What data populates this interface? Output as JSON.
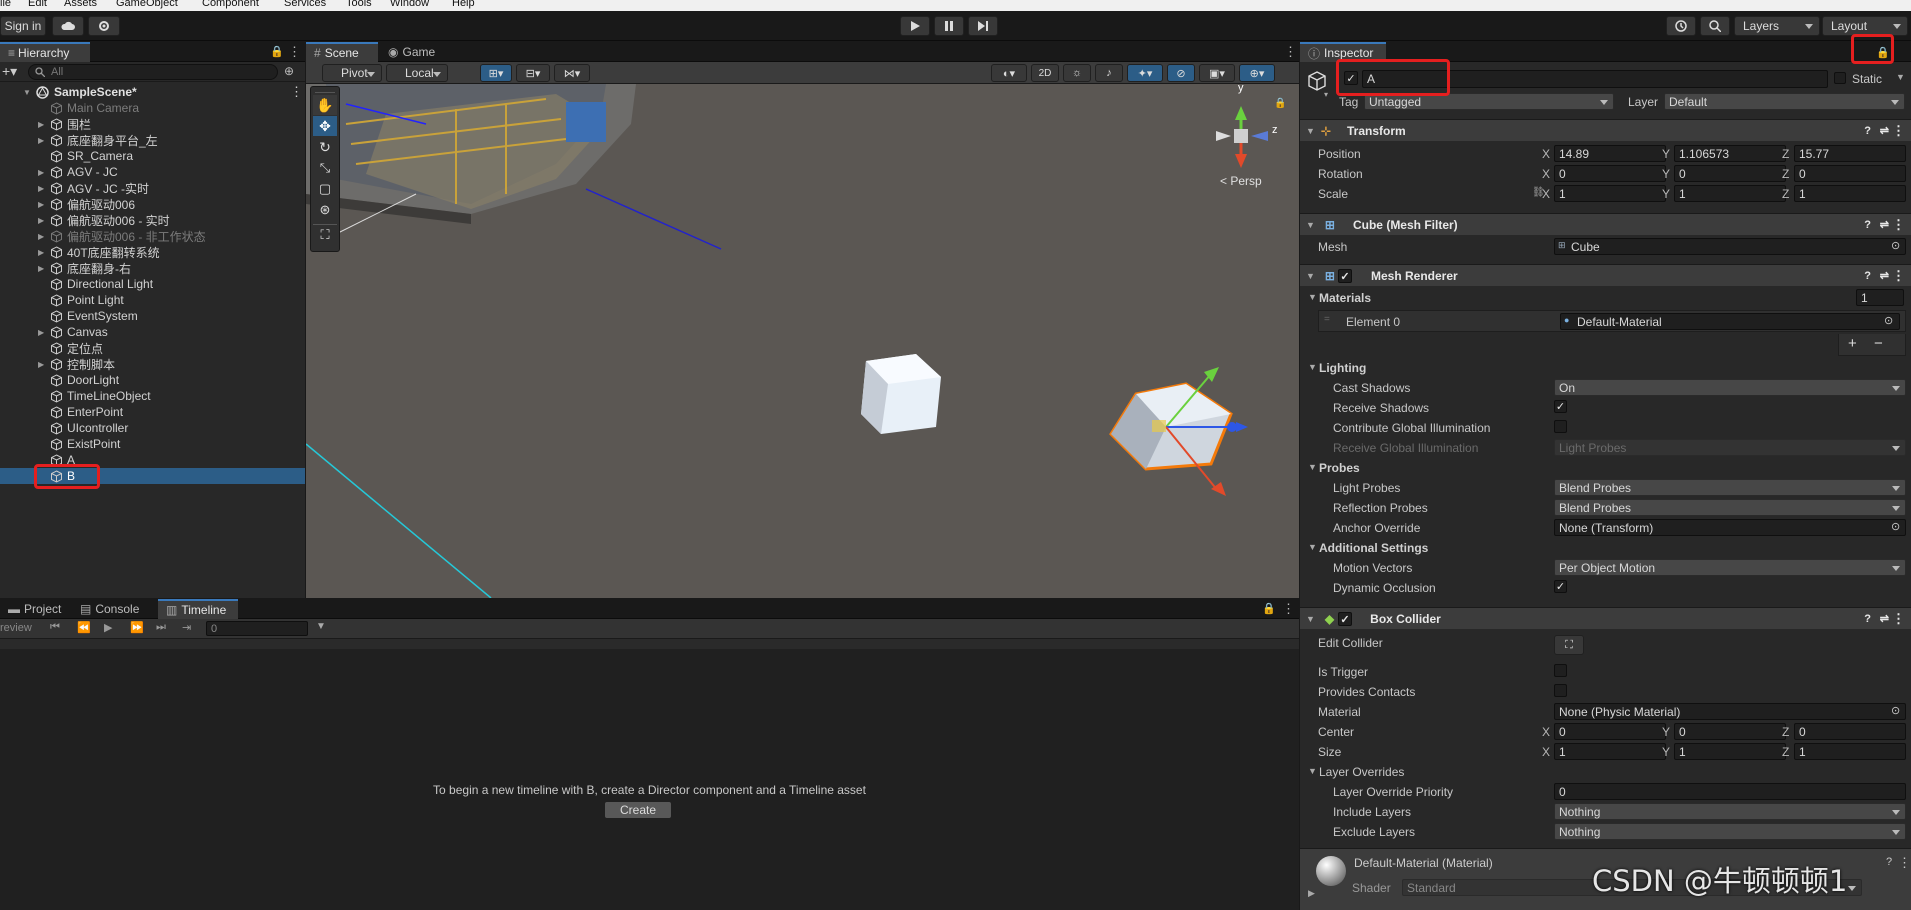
{
  "menu": [
    "ile",
    "Edit",
    "Assets",
    "GameObject",
    "Component",
    "Services",
    "Tools",
    "Window",
    "Help"
  ],
  "toolbar": {
    "sign_in": "Sign in",
    "layers": "Layers",
    "layout": "Layout"
  },
  "hierarchy": {
    "tab": "Hierarchy",
    "search_placeholder": "All",
    "scene": "SampleScene*",
    "items": [
      {
        "label": "Main Camera"
      },
      {
        "label": "围栏"
      },
      {
        "label": "底座翻身平台_左"
      },
      {
        "label": "SR_Camera"
      },
      {
        "label": "AGV - JC"
      },
      {
        "label": "AGV - JC -实时"
      },
      {
        "label": "偏航驱动006"
      },
      {
        "label": "偏航驱动006 - 实时"
      },
      {
        "label": "偏航驱动006 - 非工作状态"
      },
      {
        "label": "40T底座翻转系统"
      },
      {
        "label": "底座翻身-右"
      },
      {
        "label": "Directional Light"
      },
      {
        "label": "Point Light"
      },
      {
        "label": "EventSystem"
      },
      {
        "label": "Canvas"
      },
      {
        "label": "定位点"
      },
      {
        "label": "控制脚本"
      },
      {
        "label": "DoorLight"
      },
      {
        "label": "TimeLineObject"
      },
      {
        "label": "EnterPoint"
      },
      {
        "label": "UIcontroller"
      },
      {
        "label": "ExistPoint"
      },
      {
        "label": "A"
      },
      {
        "label": "B"
      }
    ]
  },
  "scene": {
    "tabs": [
      "Scene",
      "Game"
    ],
    "pivot": "Pivot",
    "local": "Local",
    "mode_2d": "2D",
    "persp": "< Persp",
    "gizmo_y": "y",
    "gizmo_z": "z"
  },
  "bottom": {
    "tabs": [
      "Project",
      "Console",
      "Timeline"
    ],
    "preview": "review",
    "frame": "0",
    "message": "To begin a new timeline with B, create a Director component and a Timeline asset",
    "create": "Create"
  },
  "inspector": {
    "tab": "Inspector",
    "object_name": "A",
    "static": "Static",
    "tag_label": "Tag",
    "tag": "Untagged",
    "layer_label": "Layer",
    "layer": "Default",
    "transform": {
      "title": "Transform",
      "position_label": "Position",
      "position": [
        "14.89",
        "1.106573",
        "15.77"
      ],
      "rotation_label": "Rotation",
      "rotation": [
        "0",
        "0",
        "0"
      ],
      "scale_label": "Scale",
      "scale": [
        "1",
        "1",
        "1"
      ]
    },
    "mesh_filter": {
      "title": "Cube (Mesh Filter)",
      "mesh_label": "Mesh",
      "mesh": "Cube"
    },
    "mesh_renderer": {
      "title": "Mesh Renderer",
      "materials_label": "Materials",
      "materials_count": "1",
      "element0_label": "Element 0",
      "element0": "Default-Material",
      "lighting": "Lighting",
      "cast_shadows_label": "Cast Shadows",
      "cast_shadows": "On",
      "receive_shadows_label": "Receive Shadows",
      "contribute_gi_label": "Contribute Global Illumination",
      "receive_gi_label": "Receive Global Illumination",
      "receive_gi": "Light Probes",
      "probes": "Probes",
      "light_probes_label": "Light Probes",
      "light_probes": "Blend Probes",
      "reflection_probes_label": "Reflection Probes",
      "reflection_probes": "Blend Probes",
      "anchor_override_label": "Anchor Override",
      "anchor_override": "None (Transform)",
      "additional": "Additional Settings",
      "motion_vectors_label": "Motion Vectors",
      "motion_vectors": "Per Object Motion",
      "dynamic_occlusion_label": "Dynamic Occlusion"
    },
    "box_collider": {
      "title": "Box Collider",
      "edit_collider": "Edit Collider",
      "is_trigger": "Is Trigger",
      "provides_contacts": "Provides Contacts",
      "material_label": "Material",
      "material": "None (Physic Material)",
      "center_label": "Center",
      "center": [
        "0",
        "0",
        "0"
      ],
      "size_label": "Size",
      "size": [
        "1",
        "1",
        "1"
      ],
      "layer_overrides": "Layer Overrides",
      "priority_label": "Layer Override Priority",
      "priority": "0",
      "include_label": "Include Layers",
      "include": "Nothing",
      "exclude_label": "Exclude Layers",
      "exclude": "Nothing"
    },
    "material": {
      "title": "Default-Material (Material)",
      "shader_label": "Shader",
      "shader": "Standard"
    }
  },
  "watermark": "CSDN @牛顿顿顿1",
  "colors": {
    "accent": "#3a79bb",
    "selection": "#2c5d87",
    "highlight": "#e51f1f",
    "cube_outline": "#f47a0a"
  }
}
